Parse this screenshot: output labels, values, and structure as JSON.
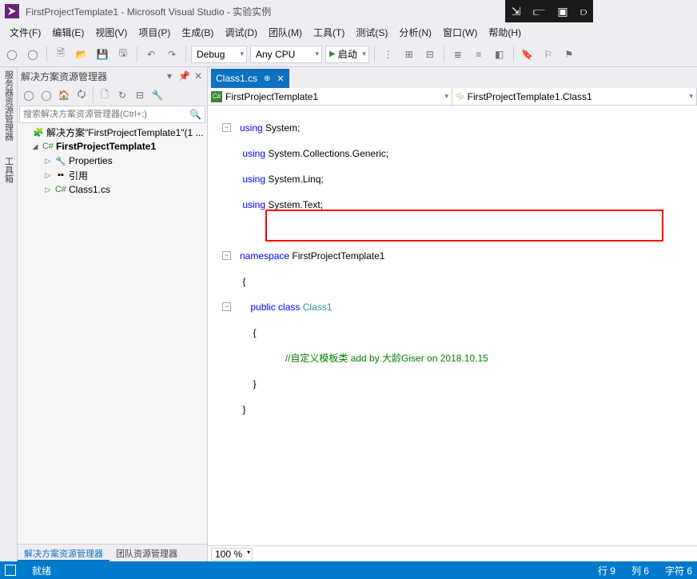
{
  "title": "FirstProjectTemplate1 - Microsoft Visual Studio  - 实验实例",
  "menu": [
    "文件(F)",
    "编辑(E)",
    "视图(V)",
    "项目(P)",
    "生成(B)",
    "调试(D)",
    "团队(M)",
    "工具(T)",
    "测试(S)",
    "分析(N)",
    "窗口(W)",
    "帮助(H)"
  ],
  "toolbar": {
    "config": "Debug",
    "platform": "Any CPU",
    "start": "启动"
  },
  "solution_explorer": {
    "title": "解决方案资源管理器",
    "search_placeholder": "搜索解决方案资源管理器(Ctrl+;)",
    "solution": "解决方案\"FirstProjectTemplate1\"(1 ...",
    "project": "FirstProjectTemplate1",
    "nodes": {
      "properties": "Properties",
      "references": "引用",
      "file": "Class1.cs"
    },
    "tabs": {
      "active": "解决方案资源管理器",
      "other": "团队资源管理器"
    }
  },
  "editor": {
    "tab": "Class1.cs",
    "nav_left": "FirstProjectTemplate1",
    "nav_right": "FirstProjectTemplate1.Class1",
    "code": {
      "l1": "using System;",
      "l2": "using System.Collections.Generic;",
      "l3": "using System.Linq;",
      "l4": "using System.Text;",
      "l5": "namespace FirstProjectTemplate1",
      "l6": "{",
      "l7a": "    public class ",
      "l7b": "Class1",
      "l8": "    {",
      "l9": "        //自定义模板类 add by 大龄Giser on 2018.10.15",
      "l10": "    }",
      "l11": "}"
    },
    "zoom": "100 %"
  },
  "status": {
    "ready": "就绪",
    "line": "行 9",
    "col": "列 6",
    "char": "字符 6"
  },
  "leftrail": {
    "a": "服务器资源管理器",
    "b": "工具箱"
  }
}
